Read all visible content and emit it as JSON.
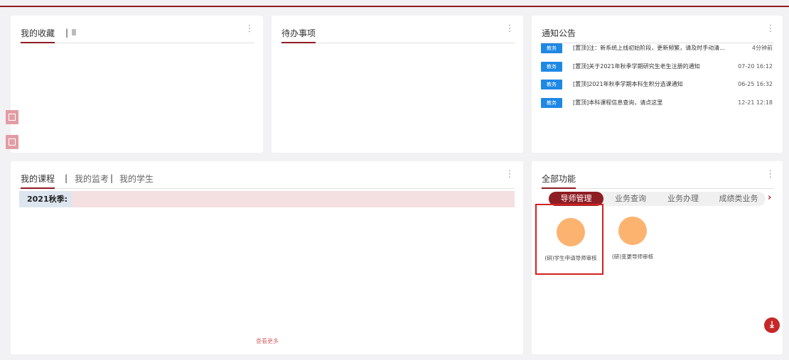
{
  "favorites": {
    "tab": "我的收藏",
    "separator": "|",
    "trash_icon": "trash-icon"
  },
  "todo": {
    "tab": "待办事项"
  },
  "notices": {
    "tab": "通知公告",
    "items": [
      {
        "tag": "教务",
        "title": "[置顶]注：新系统上线初始阶段，更新频繁，请及时手动清...",
        "time": "4分钟前"
      },
      {
        "tag": "教务",
        "title": "[置顶]关于2021年秋季学期研究生老生注册的通知",
        "time": "07-20 16:12"
      },
      {
        "tag": "教务",
        "title": "[置顶]2021年秋季学期本科生积分选课通知",
        "time": "06-25 16:32"
      },
      {
        "tag": "教务",
        "title": "[置顶]本科课程信息查询，请点这里",
        "time": "12-21 12:18"
      }
    ]
  },
  "courses": {
    "tabs": [
      "我的课程",
      "我的监考",
      "我的学生"
    ],
    "separator": "|",
    "semester": "2021秋季:",
    "view_more": "查看更多"
  },
  "functions": {
    "tab": "全部功能",
    "tabs": [
      "导师管理",
      "业务查询",
      "业务办理",
      "成绩类业务"
    ],
    "items": [
      {
        "label": "(研)学生申请导师审核",
        "color": "#fcb370"
      },
      {
        "label": "(研)变更导师审核",
        "color": "#fcb370"
      }
    ]
  },
  "colors": {
    "brand": "#8f1d24",
    "notice_tag": "#1e88e5",
    "highlight": "#d42020"
  }
}
